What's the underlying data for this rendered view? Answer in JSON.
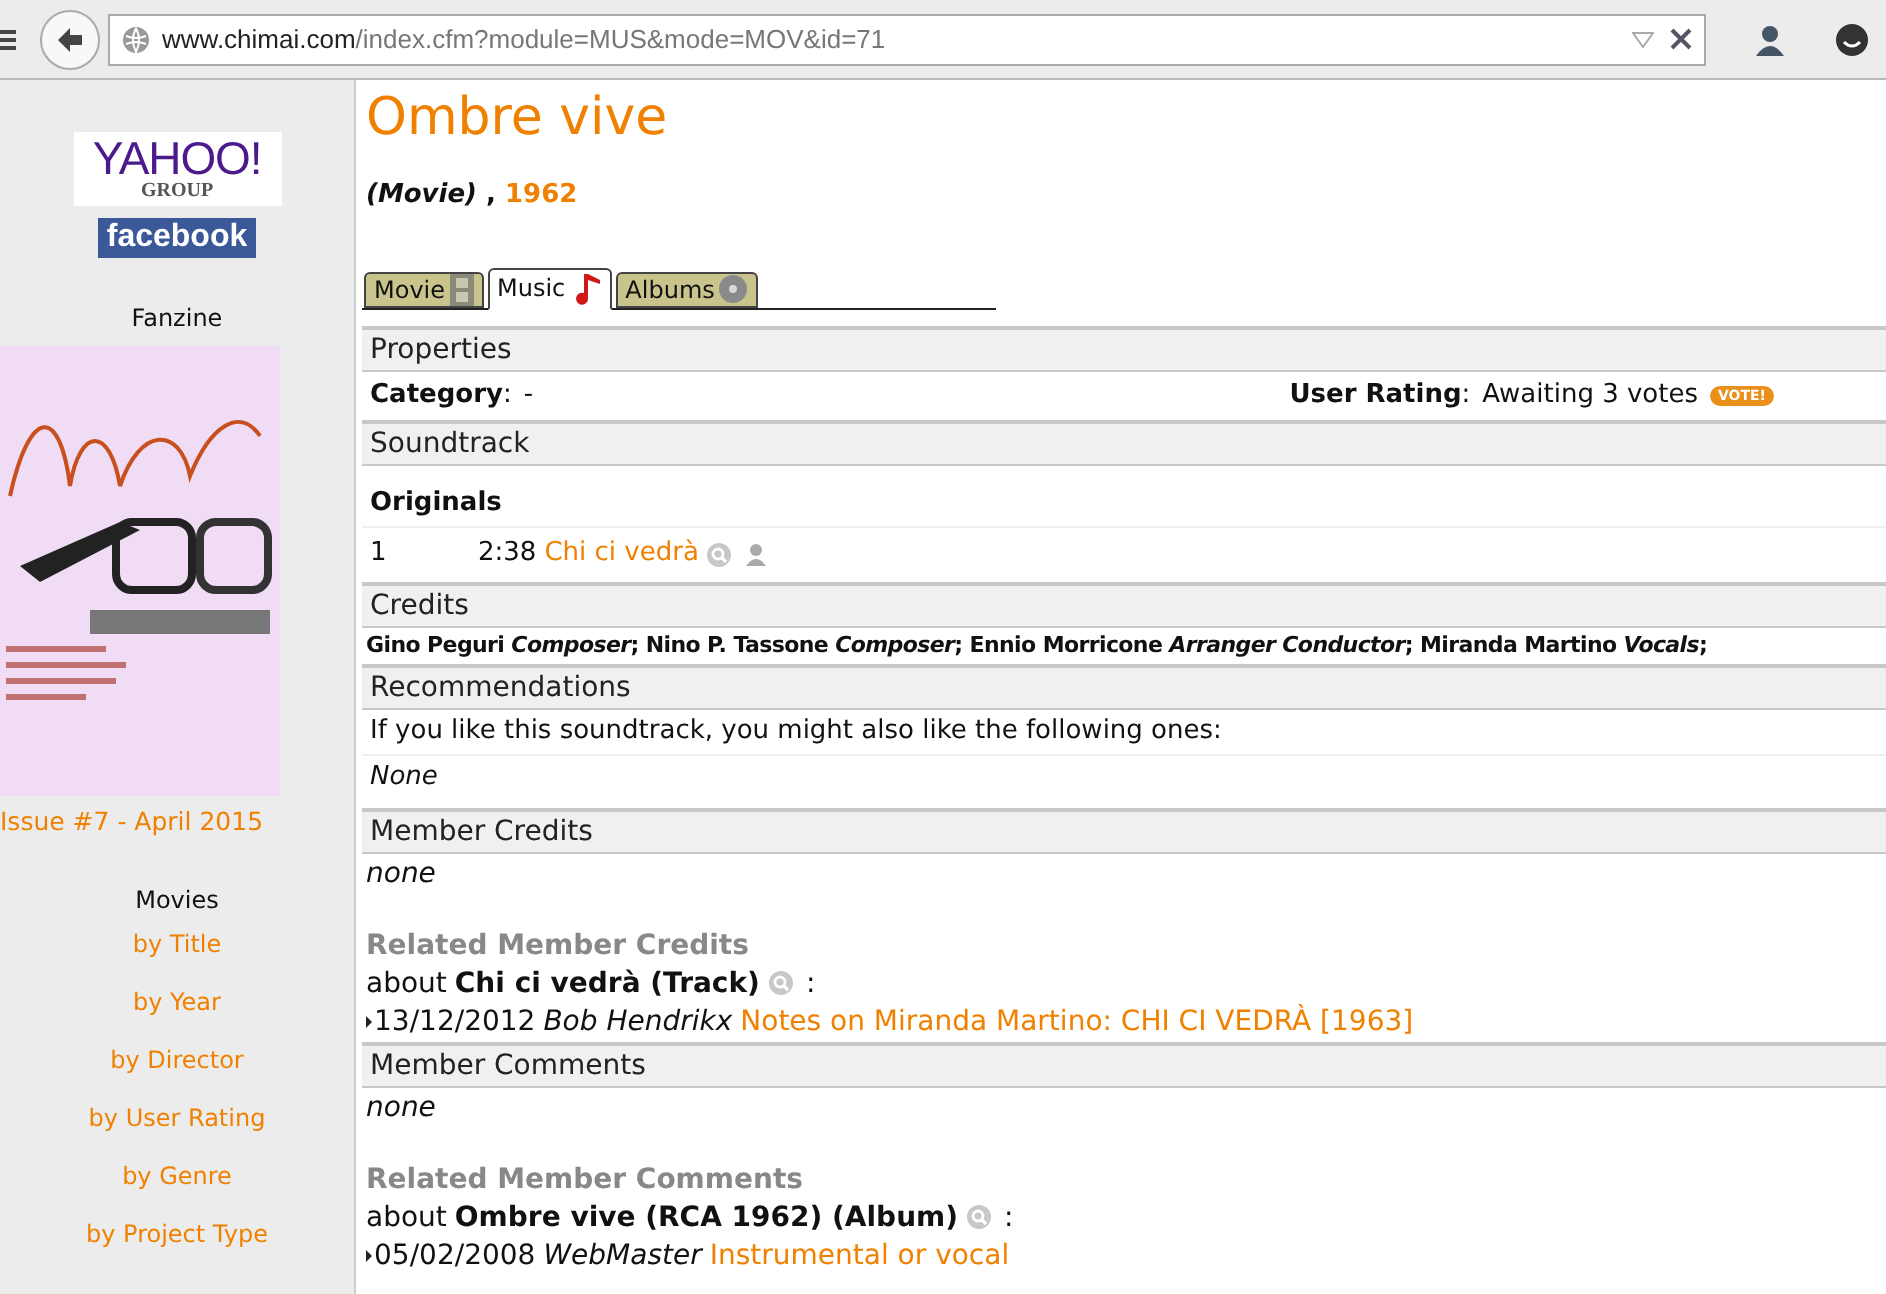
{
  "browser": {
    "url_domain": "www.chimai.com",
    "url_path": "/index.cfm?module=MUS&mode=MOV&id=71"
  },
  "sidebar": {
    "logos": [
      {
        "kind": "yahoo",
        "text": "YAHOO!",
        "subtext": "GROUP"
      },
      {
        "kind": "facebook",
        "text": "facebook"
      }
    ],
    "fanzine_heading": "Fanzine",
    "fanzine_caption": "Issue #7 - April 2015",
    "movies_heading": "Movies",
    "links": [
      "by Title",
      "by Year",
      "by Director",
      "by User Rating",
      "by Genre",
      "by Project Type"
    ]
  },
  "page": {
    "title": "Ombre vive",
    "type": "(Movie)",
    "separator": " , ",
    "year": "1962",
    "tabs": [
      {
        "label": "Movie",
        "selected": false
      },
      {
        "label": "Music",
        "selected": true
      },
      {
        "label": "Albums",
        "selected": false
      }
    ],
    "properties": {
      "heading": "Properties",
      "category_label": "Category",
      "category_colon": ":",
      "category_value": "-",
      "rating_label": "User Rating",
      "rating_colon": ":",
      "rating_value": "Awaiting 3 votes",
      "vote_badge": "VOTE!"
    },
    "soundtrack": {
      "heading": "Soundtrack",
      "group": "Originals",
      "tracks": [
        {
          "number": "1",
          "duration": "2:38",
          "title": "Chi ci vedrà"
        }
      ]
    },
    "credits": {
      "heading": "Credits",
      "text": "Gino Peguri *Composer*; Nino P. Tassone *Composer*; Ennio Morricone *Arranger Conductor*; Miranda Martino *Vocals*;"
    },
    "recommendations": {
      "heading": "Recommendations",
      "intro": "If you like this soundtrack, you might also like the following ones:",
      "value": "None"
    },
    "member_credits": {
      "heading": "Member Credits",
      "value": "none",
      "related_heading": "Related Member Credits",
      "about_prefix": "about",
      "about_subject": "Chi ci vedrà (Track)",
      "about_suffix": ":",
      "entries": [
        {
          "date": "13/12/2012",
          "author": "Bob Hendrikx",
          "link": "Notes on Miranda Martino: CHI CI VEDRÀ [1963]"
        }
      ]
    },
    "member_comments": {
      "heading": "Member Comments",
      "value": "none",
      "related_heading": "Related Member Comments",
      "about_prefix": "about",
      "about_subject": "Ombre vive (RCA 1962) (Album)",
      "about_suffix": ":",
      "entries": [
        {
          "date": "05/02/2008",
          "author": "WebMaster",
          "link": "Instrumental or vocal"
        }
      ]
    }
  }
}
